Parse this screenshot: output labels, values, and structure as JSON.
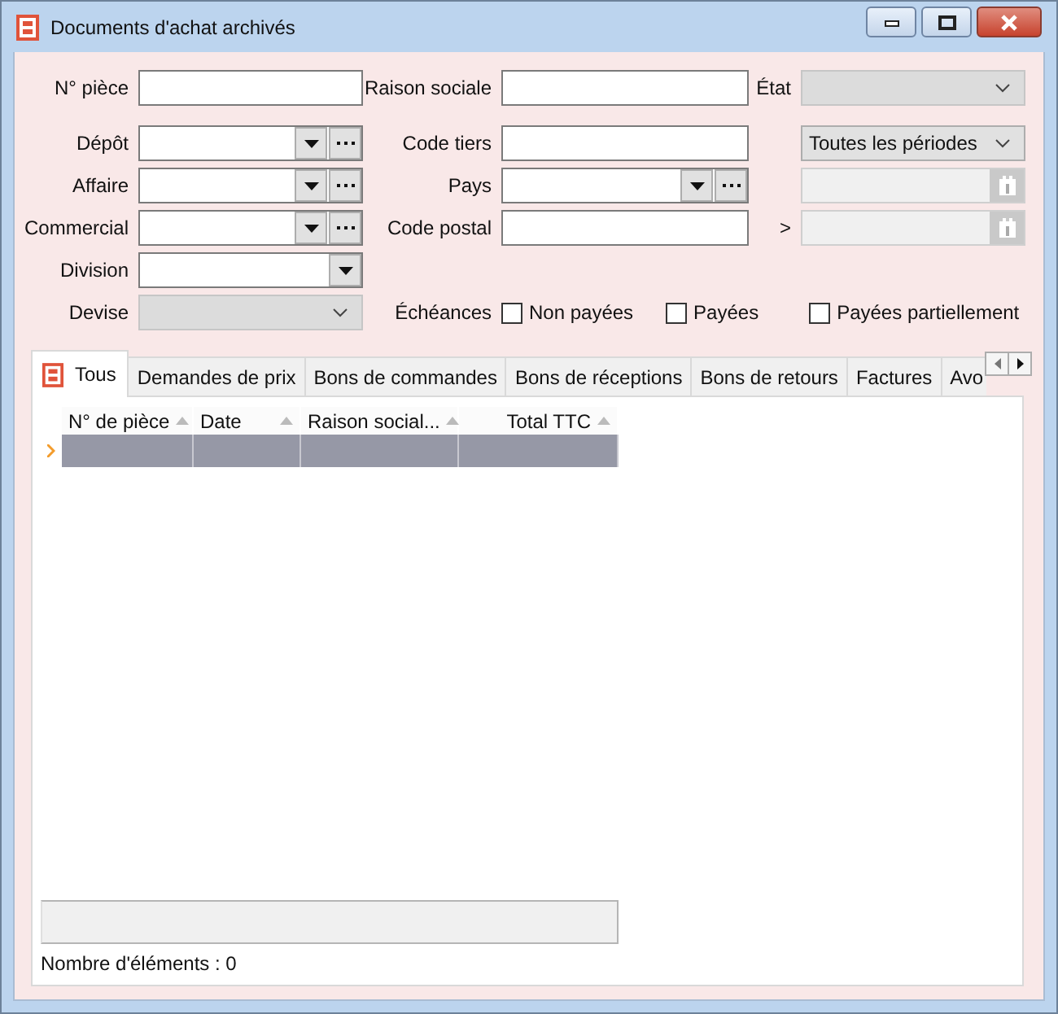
{
  "window": {
    "title": "Documents d'achat archivés"
  },
  "form_rows": [
    [
      {
        "label": "N° pièce",
        "kind": "text",
        "disabled": false
      },
      {
        "label": "Raison sociale",
        "kind": "text",
        "disabled": false
      },
      {
        "label": "État",
        "kind": "select",
        "disabled": true
      }
    ],
    [
      {
        "label": "Dépôt",
        "kind": "lookup",
        "disabled": false
      },
      {
        "label": "Code tiers",
        "kind": "text",
        "disabled": false
      },
      {
        "kind": "select",
        "value": "Toutes les périodes",
        "disabled": false
      }
    ],
    [
      {
        "label": "Affaire",
        "kind": "lookup",
        "disabled": false
      },
      {
        "label": "Pays",
        "kind": "lookup",
        "disabled": false
      },
      {
        "kind": "date",
        "disabled": true
      }
    ],
    [
      {
        "label": "Commercial",
        "kind": "lookup",
        "disabled": false
      },
      {
        "label": "Code postal",
        "kind": "text",
        "disabled": false
      },
      {
        "label": ">",
        "kind": "date",
        "disabled": true
      }
    ],
    [
      {
        "label": "Division",
        "kind": "combo",
        "disabled": false
      }
    ],
    [
      {
        "label": "Devise",
        "kind": "select",
        "disabled": true
      },
      {
        "label": "Échéances",
        "kind": "checks",
        "options": [
          {
            "label": "Non payées",
            "checked": false
          },
          {
            "label": "Payées",
            "checked": false
          },
          {
            "label": "Payées partiellement",
            "checked": false
          }
        ]
      }
    ]
  ],
  "tabs": [
    {
      "label": "Tous",
      "selected": true
    },
    {
      "label": "Demandes de prix",
      "selected": false
    },
    {
      "label": "Bons de commandes",
      "selected": false
    },
    {
      "label": "Bons de réceptions",
      "selected": false
    },
    {
      "label": "Bons de retours",
      "selected": false
    },
    {
      "label": "Factures",
      "selected": false
    },
    {
      "label": "Avo",
      "selected": false
    }
  ],
  "table": {
    "columns": [
      {
        "label": "N° de pièce"
      },
      {
        "label": "Date"
      },
      {
        "label": "Raison social..."
      },
      {
        "label": "Total TTC"
      }
    ],
    "rows": [
      {
        "selected": true
      }
    ]
  },
  "status": "Nombre d'éléments : 0"
}
